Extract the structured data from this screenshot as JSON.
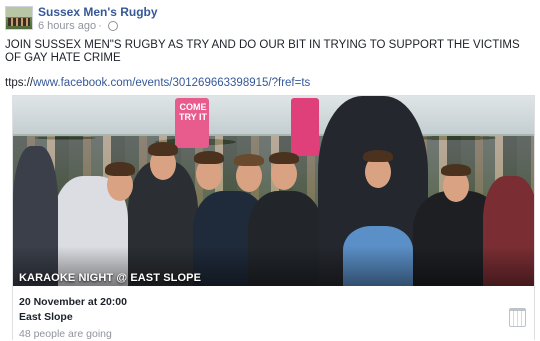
{
  "header": {
    "page_name": "Sussex Men's Rugby",
    "timestamp": "6 hours ago",
    "separator": "·"
  },
  "post": {
    "text": "JOIN SUSSEX MEN\"S RUGBY AS TRY AND DO OUR BIT IN TRYING TO SUPPORT THE VICTIMS OF GAY HATE CRIME",
    "link_prefix": "ttps://",
    "link_text": "www.facebook.com/events/301269663398915/?fref=ts"
  },
  "event": {
    "photo_banner_text": "COME TRY IT",
    "caption": "KARAOKE NIGHT @ EAST SLOPE",
    "date": "20 November at 20:00",
    "place": "East Slope",
    "going": "48 people are going"
  },
  "icons": {
    "privacy": "globe-icon",
    "calendar": "calendar-icon"
  }
}
